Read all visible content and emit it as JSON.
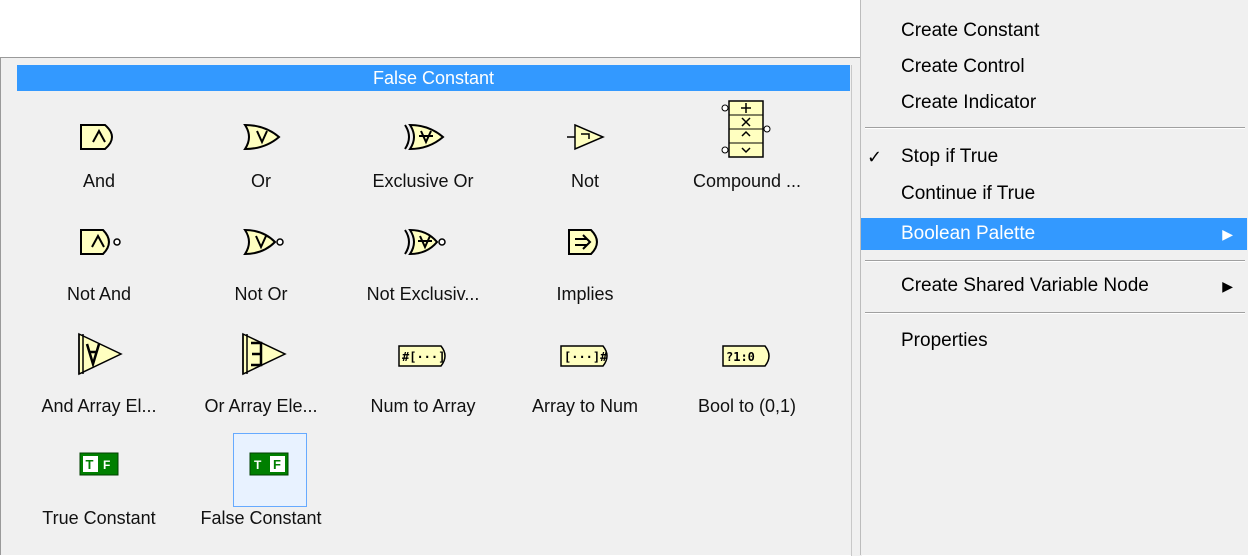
{
  "palette": {
    "title": "False Constant",
    "items": [
      {
        "label": "And",
        "icon": "and-icon"
      },
      {
        "label": "Or",
        "icon": "or-icon"
      },
      {
        "label": "Exclusive Or",
        "icon": "exclusive-or-icon"
      },
      {
        "label": "Not",
        "icon": "not-icon"
      },
      {
        "label": "Compound ...",
        "icon": "compound-arithmetic-icon"
      },
      {
        "label": "Not And",
        "icon": "not-and-icon"
      },
      {
        "label": "Not Or",
        "icon": "not-or-icon"
      },
      {
        "label": "Not Exclusiv...",
        "icon": "not-exclusive-or-icon"
      },
      {
        "label": "Implies",
        "icon": "implies-icon"
      },
      {
        "label": "And Array El...",
        "icon": "and-array-elements-icon"
      },
      {
        "label": "Or Array Ele...",
        "icon": "or-array-elements-icon"
      },
      {
        "label": "Num to Array",
        "icon": "num-to-array-icon"
      },
      {
        "label": "Array to Num",
        "icon": "array-to-num-icon"
      },
      {
        "label": "Bool to (0,1)",
        "icon": "bool-to-01-icon"
      },
      {
        "label": "True Constant",
        "icon": "true-constant-icon"
      },
      {
        "label": "False Constant",
        "icon": "false-constant-icon"
      }
    ],
    "selected": "False Constant"
  },
  "menu": {
    "items": [
      {
        "label": "Create Constant"
      },
      {
        "label": "Create Control"
      },
      {
        "label": "Create Indicator"
      },
      {
        "label": "Stop if True",
        "checked": true
      },
      {
        "label": "Continue if True"
      },
      {
        "label": "Boolean Palette",
        "submenu": true,
        "highlighted": true
      },
      {
        "label": "Create Shared Variable Node",
        "submenu": true
      },
      {
        "label": "Properties"
      }
    ],
    "check_glyph": "✓",
    "arrow_glyph": "▶"
  },
  "colors": {
    "highlight": "#3399ff",
    "icon_yellow": "#ffffc0",
    "constant_green": "#007f00"
  }
}
